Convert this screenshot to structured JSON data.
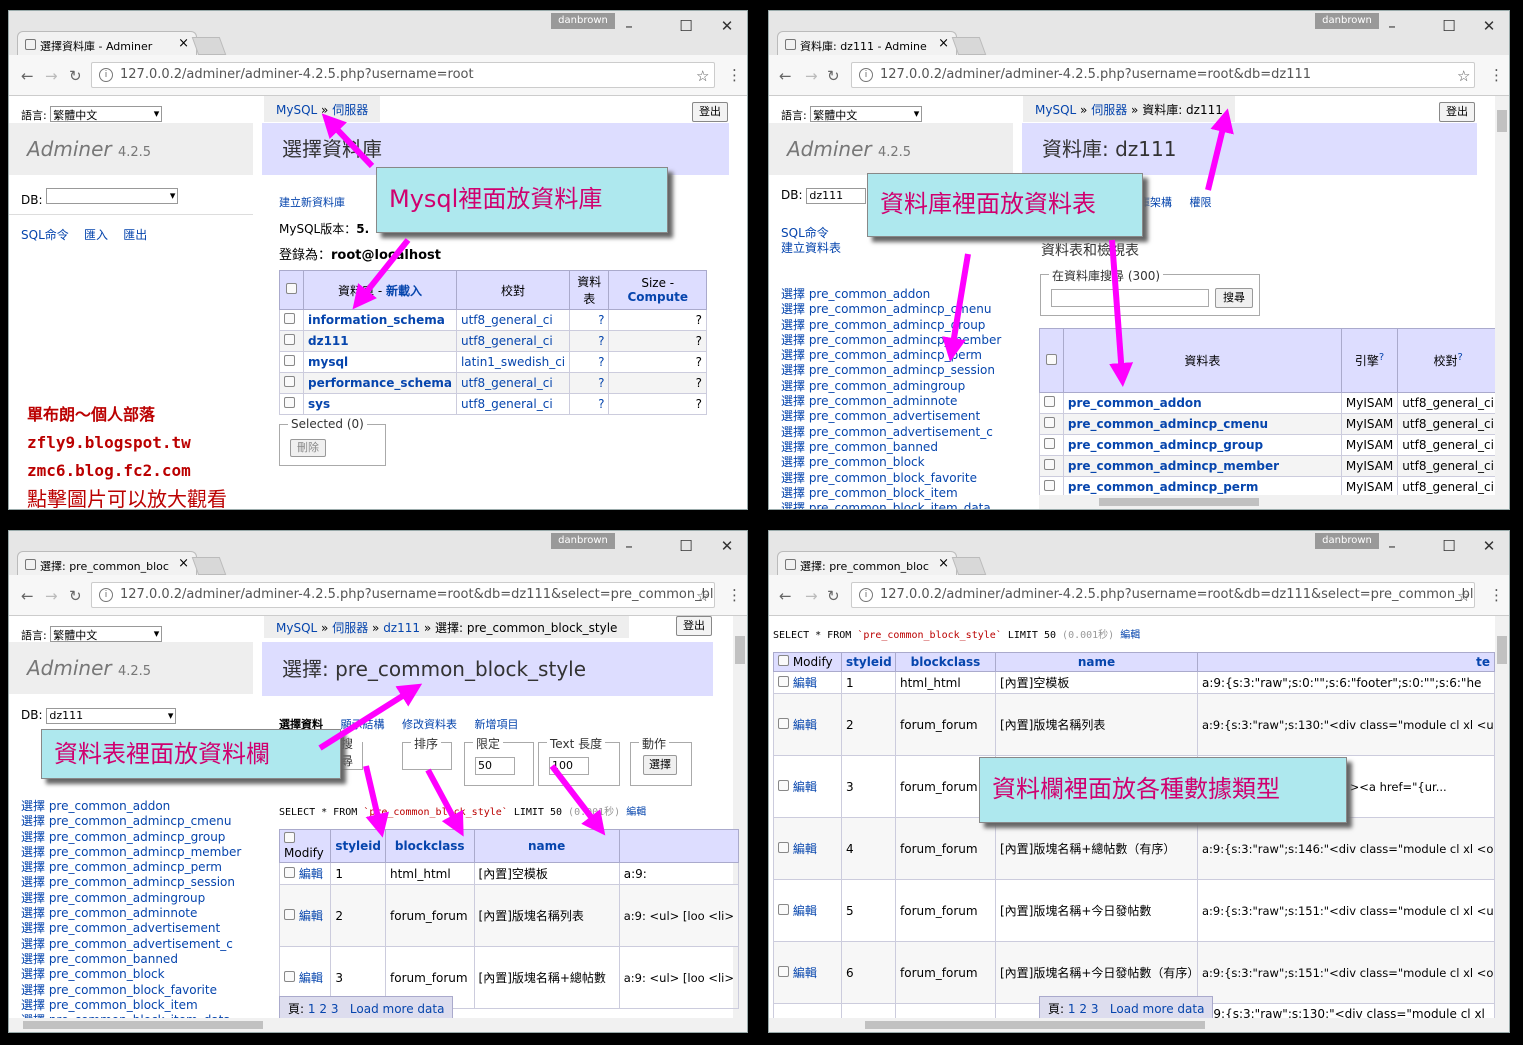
{
  "windows": [
    {
      "tab": "選擇資料庫 - Adminer",
      "url": "127.0.0.2/adminer/adminer-4.2.5.php?username=root",
      "user": "danbrown"
    },
    {
      "tab": "資料庫: dz111 - Admine",
      "url": "127.0.0.2/adminer/adminer-4.2.5.php?username=root&db=dz111",
      "user": "danbrown"
    },
    {
      "tab": "選擇: pre_common_bloc",
      "url": "127.0.0.2/adminer/adminer-4.2.5.php?username=root&db=dz111&select=pre_common_block_st",
      "user": "danbrown"
    },
    {
      "tab": "選擇: pre_common_bloc",
      "url": "127.0.0.2/adminer/adminer-4.2.5.php?username=root&db=dz111&select=pre_common_block_st",
      "user": "danbrown"
    }
  ],
  "common": {
    "lang_label": "語言:",
    "lang_value": "繁體中文",
    "brand": "Adminer",
    "version": "4.2.5",
    "logout": "登出",
    "db_label": "DB:",
    "sql_cmd": "SQL命令",
    "import": "匯入",
    "export": "匯出"
  },
  "w1": {
    "crumb_mysql": "MySQL",
    "crumb_sep": "»",
    "crumb_server": "伺服器",
    "heading": "選擇資料庫",
    "create_db": "建立新資料庫",
    "version_label": "MySQL版本：",
    "version_value": "5.",
    "login_label": "登錄為：",
    "login_value": "root@localhost",
    "col_db": "資料庫",
    "col_refresh": "新載入",
    "col_collation": "校對",
    "col_tables": "資料表",
    "col_size": "Size",
    "col_compute": "Compute",
    "rows": [
      {
        "name": "information_schema",
        "coll": "utf8_general_ci",
        "t": "?",
        "s": "?"
      },
      {
        "name": "dz111",
        "coll": "utf8_general_ci",
        "t": "?",
        "s": "?"
      },
      {
        "name": "mysql",
        "coll": "latin1_swedish_ci",
        "t": "?",
        "s": "?"
      },
      {
        "name": "performance_schema",
        "coll": "utf8_general_ci",
        "t": "?",
        "s": "?"
      },
      {
        "name": "sys",
        "coll": "utf8_general_ci",
        "t": "?",
        "s": "?"
      }
    ],
    "selected": "Selected (0)",
    "delete": "刪除",
    "blog": [
      "單布朗～個人部落",
      "zfly9.blogspot.tw",
      "zmc6.blog.fc2.com",
      "點擊圖片可以放大觀看"
    ],
    "callout": "Mysql裡面放資料庫"
  },
  "w2": {
    "crumb_db": "資料庫: dz111",
    "heading": "資料庫: dz111",
    "db_value": "dz111",
    "create_table": "建立資料表",
    "link_schema": "資料庫架構",
    "link_priv": "權限",
    "section": "資料表和檢視表",
    "search_legend": "在資料庫搜尋 (300)",
    "search_btn": "搜尋",
    "col_table": "資料表",
    "col_engine": "引擎",
    "col_coll": "校對",
    "rows": [
      {
        "name": "pre_common_addon",
        "engine": "MyISAM",
        "coll": "utf8_general_ci"
      },
      {
        "name": "pre_common_admincp_cmenu",
        "engine": "MyISAM",
        "coll": "utf8_general_ci"
      },
      {
        "name": "pre_common_admincp_group",
        "engine": "MyISAM",
        "coll": "utf8_general_ci"
      },
      {
        "name": "pre_common_admincp_member",
        "engine": "MyISAM",
        "coll": "utf8_general_ci"
      },
      {
        "name": "pre_common_admincp_perm",
        "engine": "MyISAM",
        "coll": "utf8_general_ci"
      }
    ],
    "callout": "資料庫裡面放資料表"
  },
  "tablelist": [
    "選擇 pre_common_addon",
    "選擇 pre_common_admincp_cmenu",
    "選擇 pre_common_admincp_group",
    "選擇 pre_common_admincp_member",
    "選擇 pre_common_admincp_perm",
    "選擇 pre_common_admincp_session",
    "選擇 pre_common_admingroup",
    "選擇 pre_common_adminnote",
    "選擇 pre_common_advertisement",
    "選擇 pre_common_advertisement_c",
    "選擇 pre_common_banned",
    "選擇 pre_common_block",
    "選擇 pre_common_block_favorite",
    "選擇 pre_common_block_item",
    "選擇 pre_common_block_item_data"
  ],
  "w3": {
    "crumb_table": "選擇: pre_common_block_style",
    "heading": "選擇: pre_common_block_style",
    "tabs": [
      "選擇資料",
      "顯示結構",
      "修改資料表",
      "新增項目"
    ],
    "fs_search": "搜尋",
    "fs_sort": "排序",
    "fs_limit": "限定",
    "limit_val": "50",
    "fs_text": "Text 長度",
    "text_val": "100",
    "fs_action": "動作",
    "select_btn": "選擇",
    "sql_pre": "SELECT * FROM",
    "sql_table": "`pre_common_block_style`",
    "sql_limit": "LIMIT 50",
    "sql_time": "(0.001秒)",
    "sql_edit": "編輯",
    "col_modify": "Modify",
    "col_styleid": "styleid",
    "col_blockclass": "blockclass",
    "col_name": "name",
    "rows": [
      {
        "edit": "編輯",
        "id": "1",
        "cls": "html_html",
        "name": "[內置]空模板",
        "t": "a:9:"
      },
      {
        "edit": "編輯",
        "id": "2",
        "cls": "forum_forum",
        "name": "[內置]版塊名稱列表",
        "t": "a:9:\n<ul>\n[loo\n<li>"
      },
      {
        "edit": "編輯",
        "id": "3",
        "cls": "forum_forum",
        "name": "[內置]版塊名稱+總帖數",
        "t": "a:9:\n<ul>\n[loo\n<li>"
      }
    ],
    "pager_label": "頁:",
    "pages": [
      "1",
      "2",
      "3"
    ],
    "load_more": "Load more data",
    "callout": "資料表裡面放資料欄"
  },
  "w4": {
    "col_te": "te",
    "rows": [
      {
        "edit": "編輯",
        "id": "1",
        "cls": "html_html",
        "name": "[內置]空模板",
        "t": "a:9:{s:3:\"raw\";s:0:\"\";s:6:\"footer\";s:0:\"\";s:6:\"he"
      },
      {
        "edit": "編輯",
        "id": "2",
        "cls": "forum_forum",
        "name": "[內置]版塊名稱列表",
        "t": "a:9:{s:3:\"raw\";s:130:\"<div class=\"module cl xl\n<ul>\n[loop]\n<li><a href=\"{url}\" title=\"{titl..."
      },
      {
        "edit": "編輯",
        "id": "3",
        "cls": "forum_forum",
        "name": "",
        "t": "<div class=\"module cl xl\n\n\n><a href=\"{ur..."
      },
      {
        "edit": "編輯",
        "id": "4",
        "cls": "forum_forum",
        "name": "[內置]版塊名稱+總帖數（有序）",
        "t": "a:9:{s:3:\"raw\";s:146:\"<div class=\"module cl xl\n<ol>\n[loop]\n<li><em>{posts}</em><a href=\"{ur..."
      },
      {
        "edit": "編輯",
        "id": "5",
        "cls": "forum_forum",
        "name": "[內置]版塊名稱+今日發帖數",
        "t": "a:9:{s:3:\"raw\";s:151:\"<div class=\"module cl xl\n<ul>\n[loop]\n<li><em>{todayposts}</em><a href..."
      },
      {
        "edit": "編輯",
        "id": "6",
        "cls": "forum_forum",
        "name": "[內置]版塊名稱+今日發帖數（有序）",
        "t": "a:9:{s:3:\"raw\";s:151:\"<div class=\"module cl xl\n<ol>\n[loop]\n<li><em>{todayposts}</em><a href..."
      },
      {
        "edit": "",
        "id": "",
        "cls": "",
        "name": "",
        "t": "a:9:{s:3:\"raw\";s:130:\"<div class=\"module cl xl"
      }
    ],
    "callout": "資料欄裡面放各種數據類型"
  }
}
